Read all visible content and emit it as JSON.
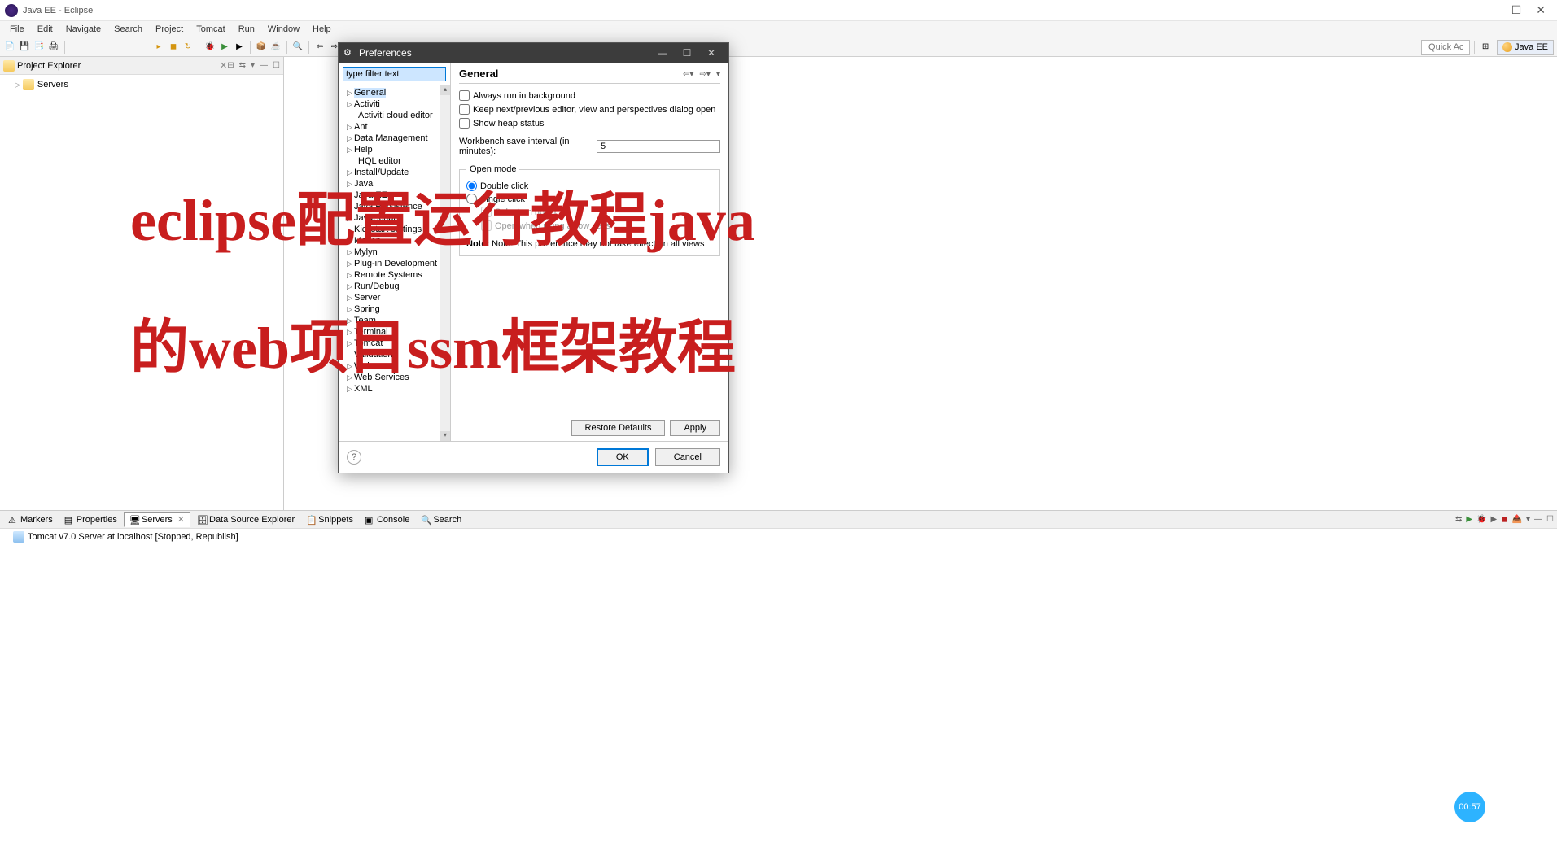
{
  "window": {
    "title": "Java EE - Eclipse"
  },
  "menubar": [
    "File",
    "Edit",
    "Navigate",
    "Search",
    "Project",
    "Tomcat",
    "Run",
    "Window",
    "Help"
  ],
  "toolbar": {
    "quick_access": "Quick Access"
  },
  "perspective": {
    "label": "Java EE"
  },
  "project_explorer": {
    "title": "Project Explorer",
    "close_glyph": "✕",
    "items": [
      {
        "label": "Servers"
      }
    ]
  },
  "bottom_tabs": [
    "Markers",
    "Properties",
    "Servers",
    "Data Source Explorer",
    "Snippets",
    "Console",
    "Search"
  ],
  "active_bottom_tab": "Servers",
  "server_row": "Tomcat v7.0 Server at localhost  [Stopped, Republish]",
  "dialog": {
    "title": "Preferences",
    "filter_placeholder": "type filter text",
    "tree": [
      {
        "label": "General",
        "expandable": true,
        "selected": true
      },
      {
        "label": "Activiti",
        "expandable": true
      },
      {
        "label": "Activiti cloud editor",
        "child": true
      },
      {
        "label": "Ant",
        "expandable": true
      },
      {
        "label": "Data Management",
        "expandable": true
      },
      {
        "label": "Help",
        "expandable": true
      },
      {
        "label": "HQL editor",
        "child": true
      },
      {
        "label": "Install/Update",
        "expandable": true
      },
      {
        "label": "Java",
        "expandable": true
      },
      {
        "label": "Java EE",
        "expandable": true
      },
      {
        "label": "Java Persistence",
        "expandable": true
      },
      {
        "label": "JavaScript",
        "expandable": true
      },
      {
        "label": "Kickstart settings"
      },
      {
        "label": "Maven",
        "expandable": true
      },
      {
        "label": "Mylyn",
        "expandable": true
      },
      {
        "label": "Plug-in Development",
        "expandable": true
      },
      {
        "label": "Remote Systems",
        "expandable": true
      },
      {
        "label": "Run/Debug",
        "expandable": true
      },
      {
        "label": "Server",
        "expandable": true
      },
      {
        "label": "Spring",
        "expandable": true
      },
      {
        "label": "Team",
        "expandable": true
      },
      {
        "label": "Terminal",
        "expandable": true
      },
      {
        "label": "Tomcat",
        "expandable": true
      },
      {
        "label": "Validation"
      },
      {
        "label": "Web",
        "expandable": true
      },
      {
        "label": "Web Services",
        "expandable": true
      },
      {
        "label": "XML",
        "expandable": true
      }
    ],
    "page_title": "General",
    "checkboxes": [
      "Always run in background",
      "Keep next/previous editor, view and perspectives dialog open",
      "Show heap status"
    ],
    "save_label": "Workbench save interval (in minutes):",
    "save_value": "5",
    "open_mode": {
      "legend": "Open mode",
      "options": [
        "Double click",
        "Single click"
      ],
      "selected": "Double click",
      "sub1": "Select on hover",
      "sub2": "Open when using arrow keys"
    },
    "note": "Note: This preference may not take effect on all views",
    "restore": "Restore Defaults",
    "apply": "Apply",
    "ok": "OK",
    "cancel": "Cancel"
  },
  "overlay": {
    "line1": "eclipse配置运行教程java",
    "line2": "的web项目ssm框架教程"
  },
  "timestamp_badge": "00:57"
}
